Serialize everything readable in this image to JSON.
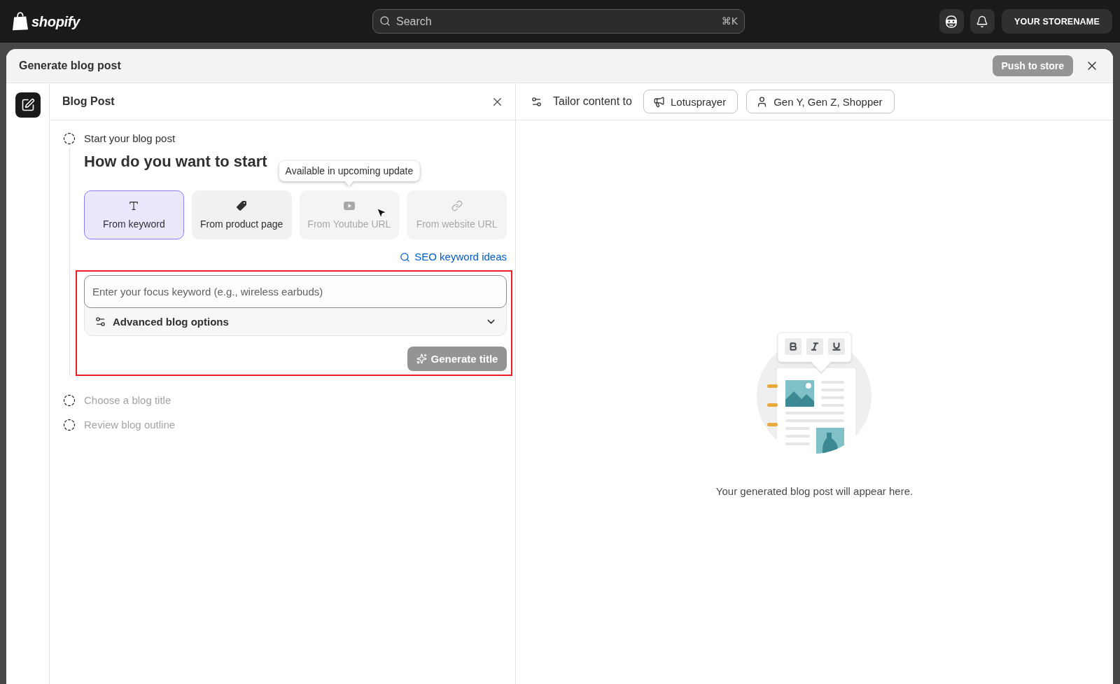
{
  "top_bar": {
    "logo_text": "shopify",
    "search": {
      "placeholder": "Search",
      "shortcut": "⌘K"
    },
    "store_button": "YOUR STORENAME"
  },
  "modal": {
    "title": "Generate blog post",
    "push_button": {
      "label": "Push to store",
      "disabled": true
    }
  },
  "editor": {
    "title": "Blog Post",
    "steps": [
      {
        "label": "Start your blog post",
        "active": true
      },
      {
        "label": "Choose a blog title",
        "active": false
      },
      {
        "label": "Review blog outline",
        "active": false
      }
    ],
    "question": "How do you want to start",
    "sources": [
      {
        "label": "From keyword",
        "selected": true,
        "disabled": false
      },
      {
        "label": "From product page",
        "selected": false,
        "disabled": false
      },
      {
        "label": "From Youtube URL",
        "selected": false,
        "disabled": true,
        "tooltip": "Available in upcoming update"
      },
      {
        "label": "From website URL",
        "selected": false,
        "disabled": true
      }
    ],
    "seo_link": "SEO keyword ideas",
    "keyword_form": {
      "highlighted": true,
      "placeholder": "Enter your focus keyword (e.g., wireless earbuds)",
      "advanced_options": {
        "label": "Advanced blog options",
        "expanded": false
      },
      "generate_button": {
        "label": "Generate title",
        "disabled": true
      }
    }
  },
  "preview": {
    "tailor_label": "Tailor content to",
    "chips": [
      "Lotusprayer",
      "Gen Y, Gen Z, Shopper"
    ],
    "empty_message": "Your generated blog post will appear here."
  }
}
